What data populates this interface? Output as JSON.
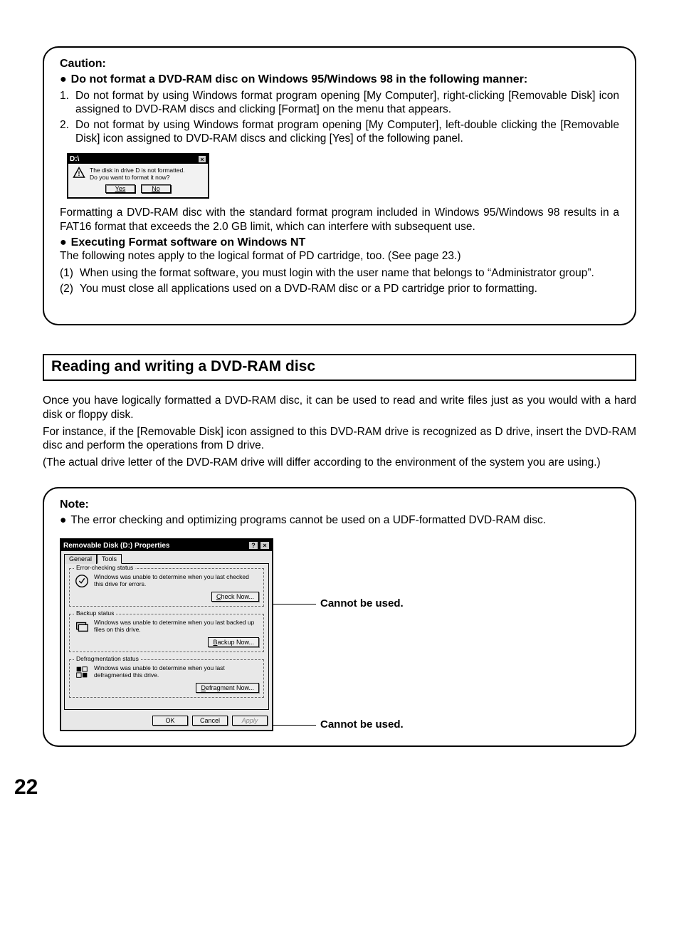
{
  "caution": {
    "title": "Caution:",
    "bullet_bold": "Do not format a DVD-RAM disc on Windows 95/Windows 98 in the following manner:",
    "items": [
      {
        "n": "1.",
        "t": "Do not format by using Windows format program opening [My Computer], right-clicking [Removable Disk] icon assigned to DVD-RAM discs and clicking [Format] on the menu that appears."
      },
      {
        "n": "2.",
        "t": "Do not format by using Windows format program opening [My Computer], left-double clicking the [Removable Disk] icon assigned to DVD-RAM discs and clicking [Yes] of the following panel."
      }
    ],
    "dialog": {
      "title": "D:\\",
      "msg1": "The disk in drive D is not formatted.",
      "msg2": "Do you want to format it now?",
      "yes": "Yes",
      "no": "No"
    },
    "para_after": "Formatting a DVD-RAM disc with the standard format program included in Windows 95/Windows 98 results in a FAT16 format that exceeds the 2.0 GB limit, which can interfere with subsequent use.",
    "sub_bullet": "Executing Format software on Windows NT",
    "sub_intro": "The following notes apply to the logical format of PD cartridge, too. (See page 23.)",
    "sub_items": [
      {
        "n": "(1)",
        "t": "When using the format software, you must login with the user name that belongs to “Administrator group”."
      },
      {
        "n": "(2)",
        "t": "You must close all applications used on a DVD-RAM disc or a PD cartridge prior to formatting."
      }
    ]
  },
  "section_title": "Reading and writing a DVD-RAM disc",
  "body_paras": [
    "Once you have logically formatted a DVD-RAM disc, it can be used to read and write files just as you would with a hard disk or floppy disk.",
    "For instance, if the [Removable Disk] icon assigned to this DVD-RAM drive is recognized as D drive, insert the DVD-RAM disc and perform the operations from D drive.",
    "(The actual drive letter of the DVD-RAM drive will differ according to the environment of the system you are using.)"
  ],
  "note": {
    "title": "Note:",
    "bullet": "The error checking and optimizing programs cannot be used on a UDF-formatted DVD-RAM disc.",
    "dialog": {
      "title": "Removable Disk (D:) Properties",
      "tabs": {
        "general": "General",
        "tools": "Tools"
      },
      "groups": [
        {
          "legend": "Error-checking status",
          "text": "Windows was unable to determine when you last checked this drive for errors.",
          "btn": "Check Now..."
        },
        {
          "legend": "Backup status",
          "text": "Windows was unable to determine when you last backed up files on this drive.",
          "btn": "Backup Now..."
        },
        {
          "legend": "Defragmentation status",
          "text": "Windows was unable to determine when you last defragmented this drive.",
          "btn": "Defragment Now..."
        }
      ],
      "ok": "OK",
      "cancel": "Cancel",
      "apply": "Apply"
    },
    "callout1": "Cannot be used.",
    "callout2": "Cannot be used."
  },
  "page_number": "22"
}
